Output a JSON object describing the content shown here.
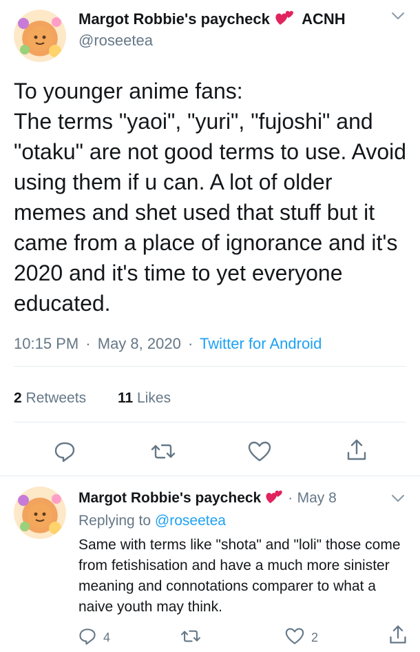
{
  "tweet": {
    "display_name": "Margot Robbie's paycheck",
    "name_suffix": "ACNH",
    "handle": "@roseetea",
    "text": "To younger anime fans:\nThe terms \"yaoi\", \"yuri\", \"fujoshi\" and \"otaku\" are not good terms to use. Avoid using them if u can. A lot of older memes and shet used that stuff but it came from a place of ignorance and it's 2020 and it's time to yet everyone educated.",
    "time": "10:15 PM",
    "date": "May 8, 2020",
    "source": "Twitter for Android",
    "retweets_count": "2",
    "retweets_label": "Retweets",
    "likes_count": "11",
    "likes_label": "Likes"
  },
  "reply": {
    "display_name": "Margot Robbie's paycheck",
    "date": "May 8",
    "replying_to_label": "Replying to",
    "replying_to_handle": "@roseetea",
    "text": "Same with terms like \"shota\" and \"loli\" those come from fetishisation and have a much more sinister meaning and connotations comparer to what a naive youth may think.",
    "reply_count": "4",
    "like_count": "2"
  },
  "separators": {
    "dot": "·"
  },
  "colors": {
    "link": "#1da1f2",
    "muted": "#657786",
    "heart_emoji": "#e0245e"
  },
  "icons": [
    "chevron-down-icon",
    "sparkling-heart-icon",
    "reply-icon",
    "retweet-icon",
    "like-icon",
    "share-icon"
  ]
}
